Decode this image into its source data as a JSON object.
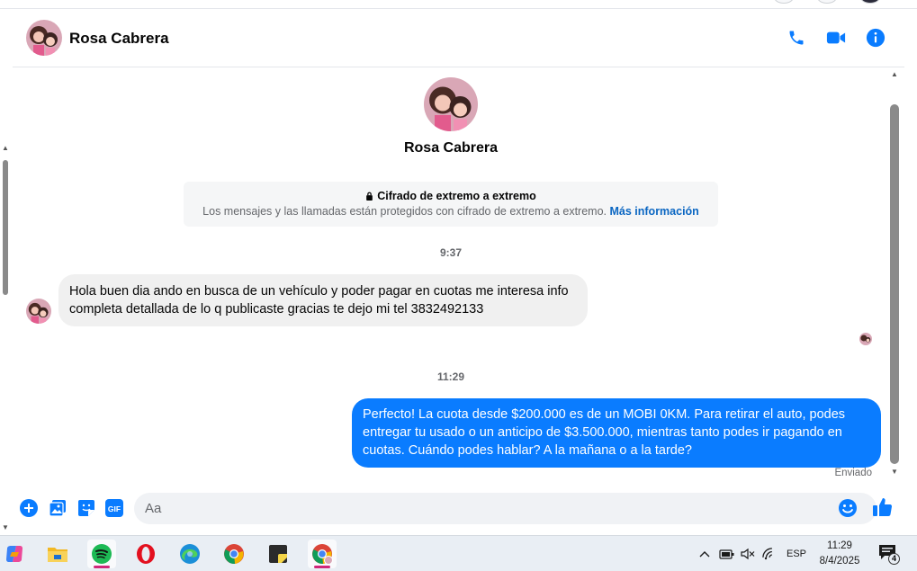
{
  "header": {
    "contact_name": "Rosa Cabrera",
    "actions": [
      "phone-icon",
      "video-camera-icon",
      "info-icon"
    ],
    "accent_color": "#0a7cff"
  },
  "profile": {
    "name": "Rosa Cabrera"
  },
  "encryption": {
    "title": "Cifrado de extremo a extremo",
    "description": "Los mensajes y las llamadas están protegidos con cifrado de extremo a extremo.",
    "link": "Más información"
  },
  "messages": [
    {
      "time": "9:37",
      "direction": "incoming",
      "text": "Hola buen dia ando en busca de un vehículo y poder pagar en cuotas me interesa info completa detallada de lo q publicaste gracias te dejo mi tel 3832492133"
    },
    {
      "time": "11:29",
      "direction": "outgoing",
      "text": "Perfecto! La cuota desde $200.000 es de un MOBI 0KM. Para retirar el auto, podes entregar tu usado o un anticipo de $3.500.000, mientras tanto podes ir pagando en cuotas. Cuándo podes hablar? A la mañana o a la tarde?",
      "status": "Enviado"
    }
  ],
  "composer": {
    "placeholder": "Aa",
    "value": "",
    "buttons": [
      "plus-icon",
      "image-icon",
      "sticker-icon",
      "gif-icon"
    ],
    "gif_label": "GIF"
  },
  "taskbar": {
    "apps": [
      "copilot-icon",
      "file-explorer-icon",
      "spotify-icon",
      "opera-icon",
      "edge-icon",
      "chrome-icon",
      "sticky-notes-icon",
      "chrome-profile-icon"
    ],
    "language": "ESP",
    "time": "11:29",
    "date": "8/4/2025",
    "notification_count": "4"
  }
}
